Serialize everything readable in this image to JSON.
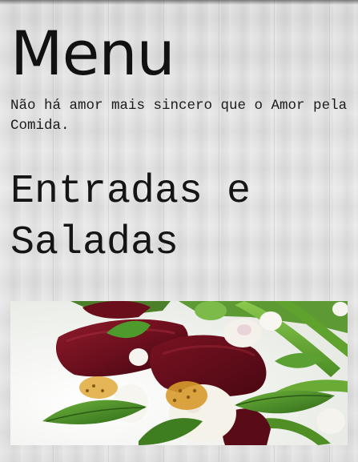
{
  "page": {
    "title": "Menu",
    "tagline": "Não há amor mais sincero que o Amor pela Comida."
  },
  "sections": [
    {
      "title": "Entradas e Saladas",
      "image": {
        "icon": "beet-goat-cheese-salad-photo"
      }
    }
  ],
  "colors": {
    "background": "#e3e3e3",
    "text": "#111111"
  }
}
